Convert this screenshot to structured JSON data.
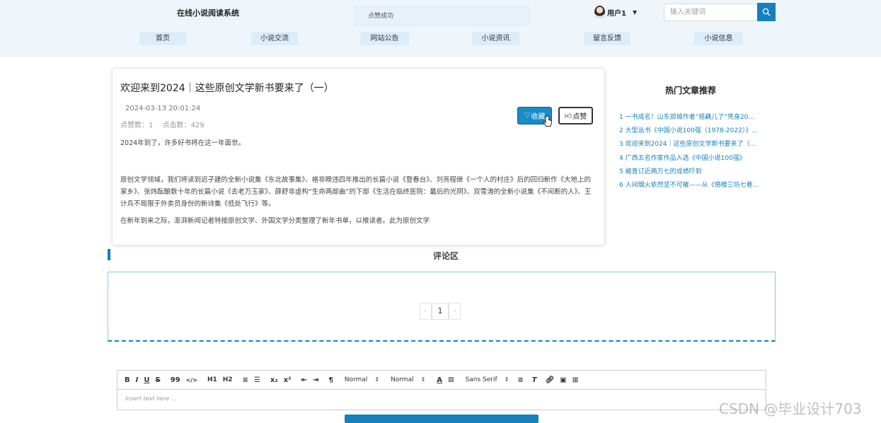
{
  "header": {
    "site_title": "在线小说阅读系统",
    "toast": "点赞成功",
    "user_name": "用户1",
    "search_placeholder": "输入关键词",
    "nav": [
      "首页",
      "小说交流",
      "网站公告",
      "小说资讯",
      "留言反馈",
      "小说信息"
    ]
  },
  "article": {
    "title": "欢迎来到2024｜这些原创文学新书要来了（一）",
    "date": "2024-03-13 20:01:24",
    "likes_label": "点赞数：1",
    "clicks_label": "点击数：429",
    "favorite_label": "收藏",
    "like_label": "点赞",
    "paragraphs": [
      "2024年到了，许多好书将在这一年面世。",
      "原创文学领域，我们将读到迟子建的全新小说集《东北故事集》、格非睽违四年推出的长篇小说《登春台》、刘亮程继《一个人的村庄》后的回归新作《大地上的家乡》、张炜酝酿数十年的长篇小说《去老万玉家》、薛舒非虚构“生命两部曲”的下部《生活在临终医院：最后的光阴》、双雪涛的全新小说集《不间断的人》、王计兵不局限于外卖员身份的新诗集《低处飞行》等。",
      "在新年到来之际，澎湃新闻记者特按原创文学、外国文学分类整理了新年书单，以飨读者。此为原创文学"
    ]
  },
  "comments": {
    "section_title": "评论区",
    "pager": {
      "prev": "‹",
      "current": "1",
      "next": "›"
    }
  },
  "sidebar": {
    "title": "热门文章推荐",
    "items": [
      "1  一书成名！山东郯城作者“摇藕儿了”凭身20...",
      "2  大型丛书《中国小说100强（1978-2022）》...",
      "3  欢迎来到2024｜这些原创文学新书要来了（...",
      "4  广西五名作家作品入选《中国小说100强》",
      "5  被昔订近两万七的成绩吓到",
      "6  人间烟火依然坚不可摧——从《倚楼三坊七巷..."
    ]
  },
  "editor": {
    "buttons": [
      "B",
      "I",
      "U",
      "S",
      "99",
      "</>",
      "H1",
      "H2",
      "≡",
      "☰",
      "x₂",
      "x²",
      "⇤",
      "⇥",
      "¶"
    ],
    "select_size": "Normal",
    "select_header": "Normal",
    "select_font": "Sans Serif",
    "placeholder": "Insert text here ..."
  },
  "watermark": "CSDN @毕业设计703",
  "colors": {
    "accent": "#1680bd",
    "header_bg": "#eef6fc"
  }
}
